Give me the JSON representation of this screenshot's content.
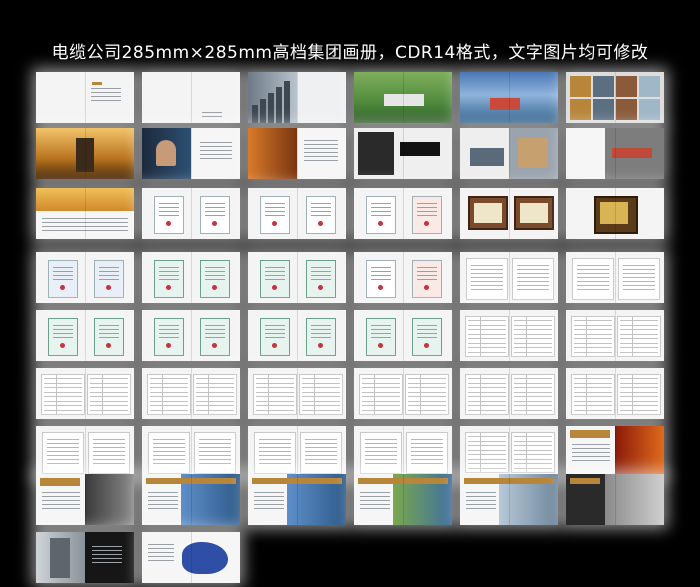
{
  "title": "电缆公司285mm×285mm高档集团画册，CDR14格式，文字图片均可修改",
  "spreads": [
    {
      "kind": "cover-white"
    },
    {
      "kind": "plain-white"
    },
    {
      "kind": "city"
    },
    {
      "kind": "factory"
    },
    {
      "kind": "harbor"
    },
    {
      "kind": "collage"
    },
    {
      "kind": "golden-city"
    },
    {
      "kind": "portrait"
    },
    {
      "kind": "sunset-text"
    },
    {
      "kind": "calligraphy"
    },
    {
      "kind": "office"
    },
    {
      "kind": "handshake"
    },
    {
      "kind": "desert"
    },
    {
      "kind": "cert-pair"
    },
    {
      "kind": "cert-pair"
    },
    {
      "kind": "cert-red"
    },
    {
      "kind": "plaques"
    },
    {
      "kind": "plaque-gold"
    },
    {
      "kind": "cert-blue"
    },
    {
      "kind": "cert-green"
    },
    {
      "kind": "cert-green"
    },
    {
      "kind": "cert-red"
    },
    {
      "kind": "doc"
    },
    {
      "kind": "doc"
    },
    {
      "kind": "cert-green"
    },
    {
      "kind": "cert-green"
    },
    {
      "kind": "cert-green"
    },
    {
      "kind": "cert-green"
    },
    {
      "kind": "table"
    },
    {
      "kind": "table"
    },
    {
      "kind": "table"
    },
    {
      "kind": "table"
    },
    {
      "kind": "table"
    },
    {
      "kind": "table"
    },
    {
      "kind": "table"
    },
    {
      "kind": "table"
    },
    {
      "kind": "doc"
    },
    {
      "kind": "doc"
    },
    {
      "kind": "doc"
    },
    {
      "kind": "doc"
    },
    {
      "kind": "table"
    },
    {
      "kind": "fire"
    },
    {
      "kind": "hands"
    },
    {
      "kind": "city-blue"
    },
    {
      "kind": "city-blue"
    },
    {
      "kind": "city-green"
    },
    {
      "kind": "buildings"
    },
    {
      "kind": "industrial"
    },
    {
      "kind": "tower"
    },
    {
      "kind": "china-map"
    }
  ],
  "colors": {
    "background": "#000000",
    "title": "#ffffff",
    "page": "#f4f4f4",
    "gold": "#b8863b",
    "seal": "#c8323c"
  }
}
